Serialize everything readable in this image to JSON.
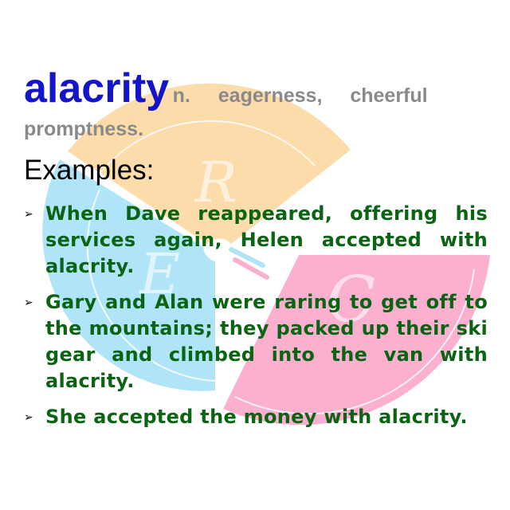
{
  "word": "alacrity",
  "definition": "n. eagerness, cheerful",
  "definition_cont": "promptness.",
  "examples_heading": "Examples:",
  "examples": [
    "When Dave reappeared, offering his services again, Helen accepted with alacrity.",
    "Gary and Alan were raring to get off to the mountains; they packed up their ski gear and climbed into the van with alacrity.",
    "She accepted the money with alacrity."
  ],
  "bullet_icon": "arrowhead-bullet",
  "watermark": {
    "letters": [
      "R",
      "E",
      "C"
    ],
    "colors": {
      "orange": "#fcdcaa",
      "blue": "#b0e4f8",
      "pink": "#fcb0d0",
      "text_green": "#0b6414",
      "word_blue": "#1414c8"
    }
  }
}
